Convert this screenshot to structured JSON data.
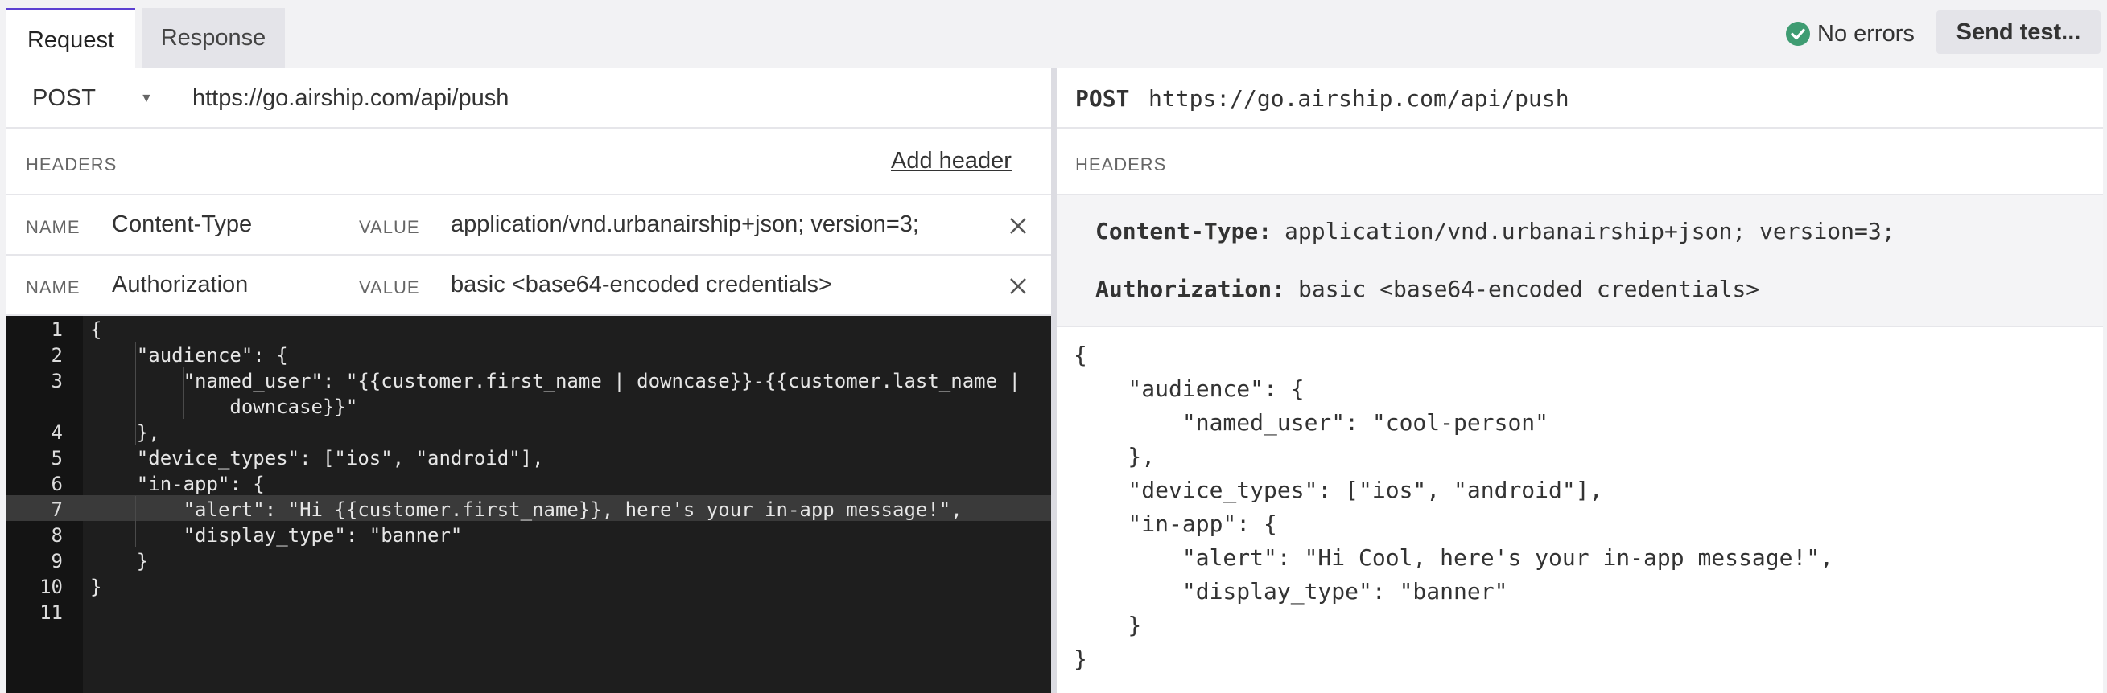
{
  "tabs": [
    "Request",
    "Response"
  ],
  "status": {
    "text": "No errors",
    "color": "#3f9c72"
  },
  "send_button": "Send test...",
  "request": {
    "method": "POST",
    "url": "https://go.airship.com/api/push",
    "headers_label": "HEADERS",
    "add_header": "Add header",
    "name_label": "NAME",
    "value_label": "VALUE",
    "headers": [
      {
        "name": "Content-Type",
        "value": "application/vnd.urbanairship+json; version=3;"
      },
      {
        "name": "Authorization",
        "value": "basic <base64-encoded credentials>"
      }
    ]
  },
  "editor": {
    "line_numbers": [
      "1",
      "2",
      "3",
      "",
      "4",
      "5",
      "6",
      "7",
      "8",
      "9",
      "10",
      "11"
    ],
    "lines": [
      "{",
      "    \"audience\": {",
      "        \"named_user\": \"{{customer.first_name | downcase}}-{{customer.last_name |",
      "            downcase}}\"",
      "    },",
      "    \"device_types\": [\"ios\", \"android\"],",
      "    \"in-app\": {",
      "        \"alert\": \"Hi {{customer.first_name}}, here's your in-app message!\",",
      "        \"display_type\": \"banner\"",
      "    }",
      "}",
      ""
    ],
    "highlighted_line": "7"
  },
  "preview": {
    "method": "POST",
    "url": "https://go.airship.com/api/push",
    "headers_label": "HEADERS",
    "headers": [
      {
        "name": "Content-Type:",
        "value": "application/vnd.urbanairship+json; version=3;"
      },
      {
        "name": "Authorization:",
        "value": "basic <base64-encoded credentials>"
      }
    ],
    "body_lines": [
      "{",
      "    \"audience\": {",
      "        \"named_user\": \"cool-person\"",
      "    },",
      "    \"device_types\": [\"ios\", \"android\"],",
      "    \"in-app\": {",
      "        \"alert\": \"Hi Cool, here's your in-app message!\",",
      "        \"display_type\": \"banner\"",
      "    }",
      "}"
    ]
  },
  "colors": {
    "accent": "#5b3fd1",
    "editor_bg": "#1e1e1e"
  }
}
